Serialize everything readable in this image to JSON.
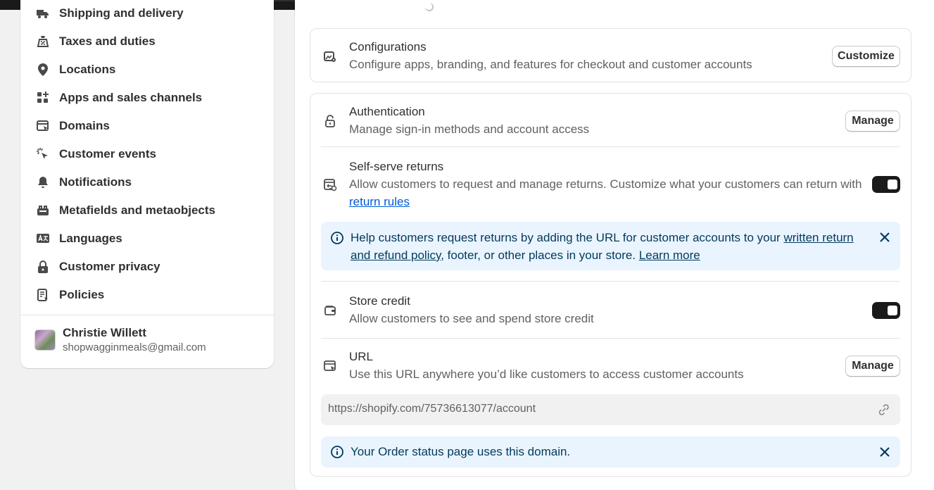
{
  "sidebar": {
    "items": [
      {
        "label": "Shipping and delivery",
        "icon": "truck-icon"
      },
      {
        "label": "Taxes and duties",
        "icon": "tax-bag-icon"
      },
      {
        "label": "Locations",
        "icon": "location-pin-icon"
      },
      {
        "label": "Apps and sales channels",
        "icon": "apps-icon"
      },
      {
        "label": "Domains",
        "icon": "domains-icon"
      },
      {
        "label": "Customer events",
        "icon": "cursor-click-icon"
      },
      {
        "label": "Notifications",
        "icon": "bell-icon"
      },
      {
        "label": "Metafields and metaobjects",
        "icon": "metafields-icon"
      },
      {
        "label": "Languages",
        "icon": "language-icon"
      },
      {
        "label": "Customer privacy",
        "icon": "lock-icon"
      },
      {
        "label": "Policies",
        "icon": "policies-icon"
      }
    ],
    "user": {
      "name": "Christie Willett",
      "email": "shopwagginmeals@gmail.com"
    }
  },
  "configurations": {
    "title": "Configurations",
    "description": "Configure apps, branding, and features for checkout and customer accounts",
    "button": "Customize"
  },
  "authentication": {
    "title": "Authentication",
    "description": "Manage sign-in methods and account access",
    "button": "Manage"
  },
  "self_serve_returns": {
    "title": "Self-serve returns",
    "description_prefix": "Allow customers to request and manage returns. Customize what your customers can return with ",
    "link": "return rules",
    "enabled": true,
    "banner": {
      "prefix": "Help customers request returns by adding the URL for customer accounts to your ",
      "link1": "written return and refund policy",
      "middle": ", footer, or other places in your store. ",
      "link2": "Learn more"
    }
  },
  "store_credit": {
    "title": "Store credit",
    "description": "Allow customers to see and spend store credit",
    "enabled": true
  },
  "url_section": {
    "title": "URL",
    "description": "Use this URL anywhere you’d like customers to access customer accounts",
    "button": "Manage",
    "url": "https://shopify.com/75736613077/account",
    "banner": "Your Order status page uses this domain."
  },
  "colors": {
    "toggle_on": "#1a1a1a",
    "banner_bg": "#eaf4ff",
    "link": "#005bd3"
  }
}
